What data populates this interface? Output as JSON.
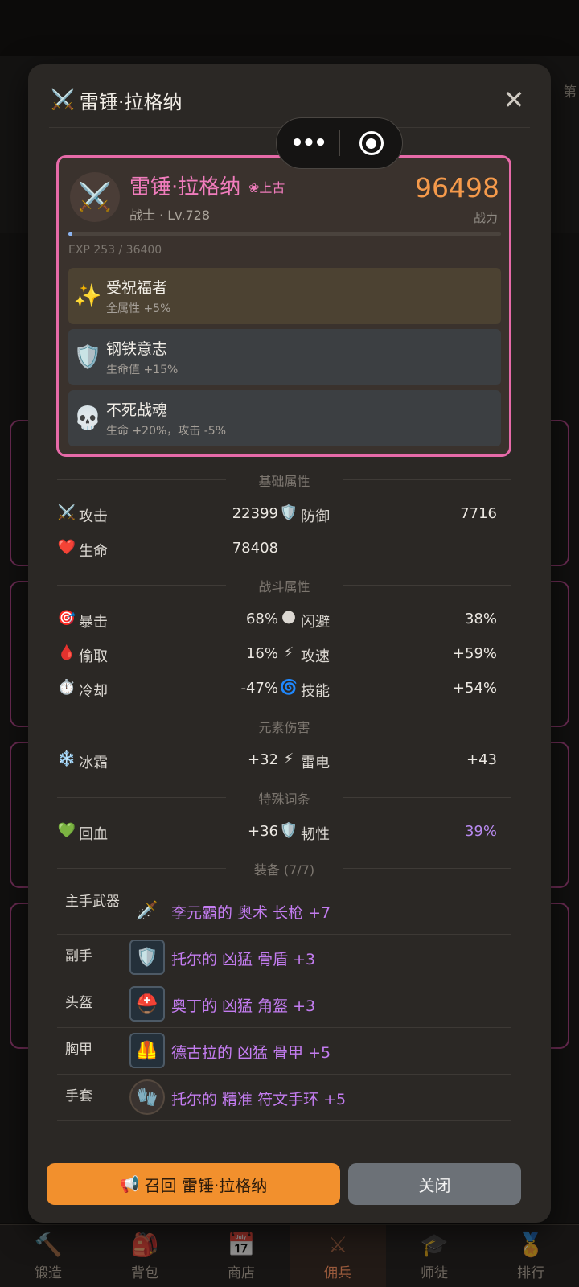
{
  "modal": {
    "title_icon": "crossed-swords-icon",
    "title": "雷锤·拉格纳",
    "close_glyph": "✕"
  },
  "capsule": {
    "dots": "•••"
  },
  "hero": {
    "name": "雷锤·拉格纳",
    "rarity": "❀上古",
    "class_level": "战士 · Lv.728",
    "power": "96498",
    "power_label": "战力",
    "exp_text": "EXP 253 / 36400",
    "exp_fraction": 0.007
  },
  "traits": [
    {
      "icon": "sparkles-icon",
      "name": "受祝福者",
      "desc": "全属性 +5%"
    },
    {
      "icon": "shield-icon",
      "name": "钢铁意志",
      "desc": "生命值 +15%"
    },
    {
      "icon": "skull-icon",
      "name": "不死战魂",
      "desc": "生命 +20%，攻击 -5%"
    }
  ],
  "sections": {
    "basic": "基础属性",
    "combat": "战斗属性",
    "element": "元素伤害",
    "special": "特殊词条",
    "equip": "装备 (7/7)"
  },
  "stats": {
    "attack": {
      "label": "攻击",
      "value": "22399"
    },
    "defense": {
      "label": "防御",
      "value": "7716"
    },
    "hp": {
      "label": "生命",
      "value": "78408"
    },
    "crit": {
      "label": "暴击",
      "value": "68%"
    },
    "dodge": {
      "label": "闪避",
      "value": "38%"
    },
    "lifesteal": {
      "label": "偷取",
      "value": "16%"
    },
    "atk_speed": {
      "label": "攻速",
      "value": "+59%"
    },
    "cooldown": {
      "label": "冷却",
      "value": "-47%"
    },
    "skill": {
      "label": "技能",
      "value": "+54%"
    },
    "frost": {
      "label": "冰霜",
      "value": "+32"
    },
    "thunder": {
      "label": "雷电",
      "value": "+43"
    },
    "regen": {
      "label": "回血",
      "value": "+36"
    },
    "toughness": {
      "label": "韧性",
      "value": "39%"
    }
  },
  "equipment": [
    {
      "slot": "主手武器",
      "icon": "spear-icon",
      "name": "李元霸的 奥术 长枪 +7"
    },
    {
      "slot": "副手",
      "icon": "bone-shield-icon",
      "name": "托尔的 凶猛 骨盾 +3"
    },
    {
      "slot": "头盔",
      "icon": "horned-helmet-icon",
      "name": "奥丁的 凶猛 角盔 +3"
    },
    {
      "slot": "胸甲",
      "icon": "bone-armor-icon",
      "name": "德古拉的 凶猛 骨甲 +5"
    },
    {
      "slot": "手套",
      "icon": "rune-bracer-icon",
      "name": "托尔的 精准 符文手环 +5"
    }
  ],
  "buttons": {
    "recall_icon": "megaphone-icon",
    "recall": "召回 雷锤·拉格纳",
    "close": "关闭"
  },
  "background_tabs": [
    {
      "icon": "hammer-icon",
      "label": "锻造"
    },
    {
      "icon": "backpack-icon",
      "label": "背包"
    },
    {
      "icon": "shop-icon",
      "label": "商店"
    },
    {
      "icon": "crossed-swords-icon",
      "label": "佣兵"
    },
    {
      "icon": "graduation-cap-icon",
      "label": "师徒"
    },
    {
      "icon": "medal-icon",
      "label": "排行"
    }
  ],
  "background_side_text": "第",
  "colors": {
    "accent_pink": "#e66aa8",
    "power_orange": "#f59a4b",
    "epic_purple": "#c37cf0",
    "button_orange": "#f2902d"
  }
}
